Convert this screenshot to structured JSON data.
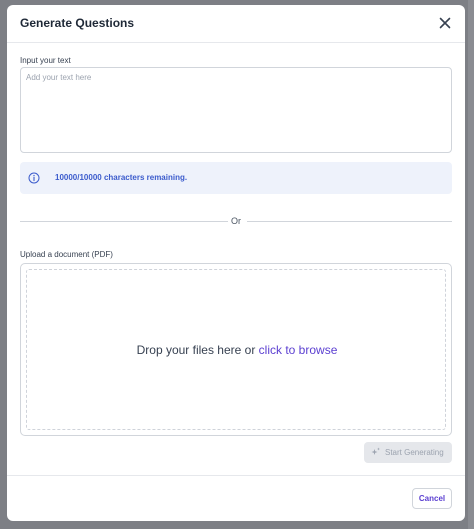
{
  "colors": {
    "accent": "#5b3fd1",
    "info_text": "#3b5bcc",
    "info_bg": "#eef2fb",
    "backdrop": "#7d7f85"
  },
  "modal": {
    "title": "Generate Questions",
    "close_icon": "close-icon"
  },
  "text_input": {
    "label": "Input your text",
    "placeholder": "Add your text here",
    "value": ""
  },
  "info": {
    "icon": "info-icon",
    "message": "10000/10000 characters remaining."
  },
  "divider": {
    "label": "Or"
  },
  "upload": {
    "label": "Upload a document (PDF)",
    "drop_text": "Drop your files here or ",
    "browse_link": "click to browse"
  },
  "actions": {
    "generate_label": "Start Generating",
    "generate_icon": "sparkle-icon",
    "generate_disabled": true,
    "cancel_label": "Cancel"
  }
}
